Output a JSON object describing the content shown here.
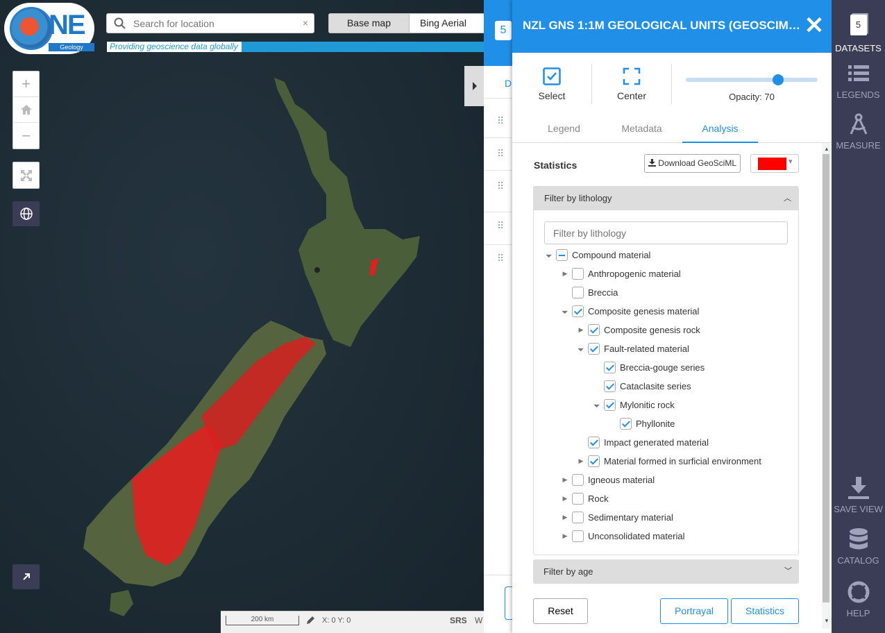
{
  "header": {
    "logo_text": "NE",
    "logo_sub": "Geology",
    "tagline": "Providing geoscience data globally",
    "search_placeholder": "Search for location",
    "basemap_label": "Base map",
    "basemap_value": "Bing Aerial"
  },
  "status": {
    "scale": "200 km",
    "coords": "X: 0 Y: 0",
    "srs_label": "SRS",
    "srs_value": "W"
  },
  "datasets_panel": {
    "count": "5",
    "tab_letter": "D"
  },
  "layer_panel": {
    "title": "NZL GNS 1:1M GEOLOGICAL UNITS (GEOSCIML ...",
    "select_label": "Select",
    "center_label": "Center",
    "opacity_label": "Opacity: 70",
    "opacity_value": 70,
    "tabs": [
      "Legend",
      "Metadata",
      "Analysis"
    ],
    "active_tab": "Analysis",
    "statistics_label": "Statistics",
    "download_label": "Download GeoSciML",
    "highlight_color": "#ff0000",
    "filter_lithology_title": "Filter by lithology",
    "filter_lithology_placeholder": "Filter by lithology",
    "tree": [
      {
        "label": "Compound material",
        "state": "partial",
        "expander": "open"
      },
      {
        "label": "Anthropogenic material",
        "state": "unchecked",
        "expander": "closed"
      },
      {
        "label": "Breccia",
        "state": "unchecked",
        "expander": "none"
      },
      {
        "label": "Composite genesis material",
        "state": "checked",
        "expander": "open"
      },
      {
        "label": "Composite genesis rock",
        "state": "checked",
        "expander": "closed"
      },
      {
        "label": "Fault-related material",
        "state": "checked",
        "expander": "open"
      },
      {
        "label": "Breccia-gouge series",
        "state": "checked",
        "expander": "none"
      },
      {
        "label": "Cataclasite series",
        "state": "checked",
        "expander": "none"
      },
      {
        "label": "Mylonitic rock",
        "state": "checked",
        "expander": "open"
      },
      {
        "label": "Phyllonite",
        "state": "checked",
        "expander": "none"
      },
      {
        "label": "Impact generated material",
        "state": "checked",
        "expander": "none"
      },
      {
        "label": "Material formed in surficial environment",
        "state": "checked",
        "expander": "closed"
      },
      {
        "label": "Igneous material",
        "state": "unchecked",
        "expander": "closed"
      },
      {
        "label": "Rock",
        "state": "unchecked",
        "expander": "closed"
      },
      {
        "label": "Sedimentary material",
        "state": "unchecked",
        "expander": "closed"
      },
      {
        "label": "Unconsolidated material",
        "state": "unchecked",
        "expander": "closed"
      }
    ],
    "filter_age_title": "Filter by age",
    "reset_label": "Reset",
    "portrayal_label": "Portrayal",
    "statistics_button_label": "Statistics"
  },
  "sidebar": {
    "datasets_count": "5",
    "items": [
      {
        "label": "DATASETS",
        "icon": "datasets-icon"
      },
      {
        "label": "LEGENDS",
        "icon": "legends-icon"
      },
      {
        "label": "MEASURE",
        "icon": "measure-icon"
      },
      {
        "label": "SAVE VIEW",
        "icon": "download-icon"
      },
      {
        "label": "CATALOG",
        "icon": "database-icon"
      },
      {
        "label": "HELP",
        "icon": "lifebuoy-icon"
      }
    ]
  }
}
